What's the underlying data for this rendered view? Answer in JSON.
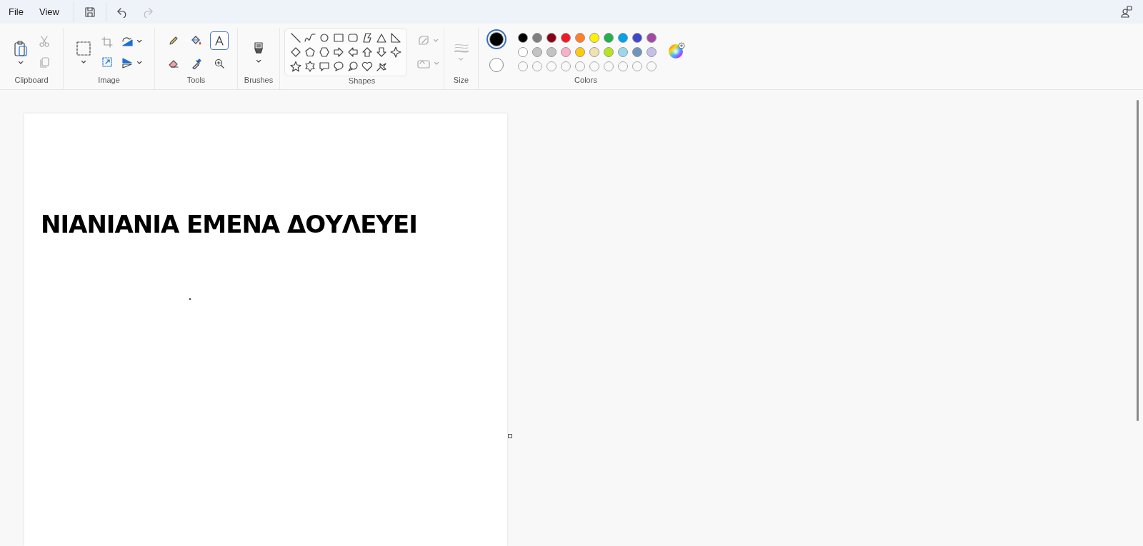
{
  "menu": [
    {
      "label": "File"
    },
    {
      "label": "View"
    }
  ],
  "ribbon": {
    "groups": [
      {
        "kind": "clipboard",
        "label": "Clipboard"
      },
      {
        "kind": "image",
        "label": "Image"
      },
      {
        "kind": "tools",
        "label": "Tools"
      },
      {
        "kind": "brushes",
        "label": "Brushes"
      },
      {
        "kind": "shapes",
        "label": "Shapes"
      },
      {
        "kind": "size",
        "label": "Size"
      },
      {
        "kind": "colors",
        "label": "Colors"
      }
    ]
  },
  "tools": [
    {
      "kind": "pencil",
      "selected": false
    },
    {
      "kind": "fill",
      "selected": false
    },
    {
      "kind": "text",
      "selected": true
    },
    {
      "kind": "eraser",
      "selected": false
    },
    {
      "kind": "picker",
      "selected": false
    },
    {
      "kind": "magnifier",
      "selected": false
    }
  ],
  "current_colors": [
    {
      "color": "#000000",
      "selected": true
    },
    {
      "color": "#ffffff",
      "selected": false
    }
  ],
  "palette": [
    {
      "kind": "color",
      "color": "#000000"
    },
    {
      "kind": "color",
      "color": "#7f7f7f"
    },
    {
      "kind": "color",
      "color": "#880015"
    },
    {
      "kind": "color",
      "color": "#ed1c24"
    },
    {
      "kind": "color",
      "color": "#ff7f27"
    },
    {
      "kind": "color",
      "color": "#fff200"
    },
    {
      "kind": "color",
      "color": "#22b14c"
    },
    {
      "kind": "color",
      "color": "#00a2e8"
    },
    {
      "kind": "color",
      "color": "#3f48cc"
    },
    {
      "kind": "color",
      "color": "#a349a4"
    },
    {
      "kind": "color",
      "color": "#ffffff"
    },
    {
      "kind": "color",
      "color": "#c3c3c3"
    },
    {
      "kind": "color",
      "color": "#c3c3c3"
    },
    {
      "kind": "color",
      "color": "#ffaec9"
    },
    {
      "kind": "color",
      "color": "#ffc90e"
    },
    {
      "kind": "color",
      "color": "#efe4b0"
    },
    {
      "kind": "color",
      "color": "#b5e61d"
    },
    {
      "kind": "color",
      "color": "#99d9ea"
    },
    {
      "kind": "color",
      "color": "#7092be"
    },
    {
      "kind": "color",
      "color": "#c8bfe7"
    },
    {
      "kind": "empty"
    },
    {
      "kind": "empty"
    },
    {
      "kind": "empty"
    },
    {
      "kind": "empty"
    },
    {
      "kind": "empty"
    },
    {
      "kind": "empty"
    },
    {
      "kind": "empty"
    },
    {
      "kind": "empty"
    },
    {
      "kind": "empty"
    },
    {
      "kind": "empty"
    }
  ],
  "canvas": {
    "text": "ΝΙΑΝΙΑΝΙΑ ΕΜΕΝΑ ΔΟΥΛΕΥΕΙ"
  }
}
